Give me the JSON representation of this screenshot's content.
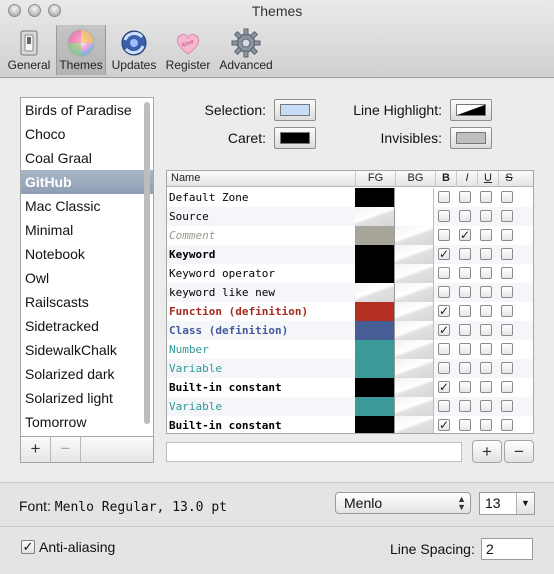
{
  "window": {
    "title": "Themes"
  },
  "toolbar": {
    "items": [
      {
        "label": "General",
        "icon": "switch-icon"
      },
      {
        "label": "Themes",
        "icon": "color-wheel-icon"
      },
      {
        "label": "Updates",
        "icon": "sync-globe-icon"
      },
      {
        "label": "Register",
        "icon": "candy-heart-icon"
      },
      {
        "label": "Advanced",
        "icon": "gear-icon"
      }
    ],
    "selected": "Themes"
  },
  "themes": {
    "items": [
      "Birds of Paradise",
      "Choco",
      "Coal Graal",
      "GitHub",
      "Mac Classic",
      "Minimal",
      "Notebook",
      "Owl",
      "Railscasts",
      "Sidetracked",
      "SidewalkChalk",
      "Solarized dark",
      "Solarized light",
      "Tomorrow"
    ],
    "selected": "GitHub",
    "add_label": "+",
    "remove_label": "−"
  },
  "wells": {
    "selection_label": "Selection:",
    "selection_color": "#c6dcf7",
    "caret_label": "Caret:",
    "caret_color": "#000000",
    "line_highlight_label": "Line Highlight:",
    "invisibles_label": "Invisibles:",
    "invisibles_color": "#bfbfbf"
  },
  "table": {
    "headers": {
      "name": "Name",
      "fg": "FG",
      "bg": "BG",
      "b": "B",
      "i": "I",
      "u": "U",
      "s": "S"
    },
    "rows": [
      {
        "name": "Default Zone",
        "fg": "#000000",
        "bg": "#ffffff",
        "b": false,
        "i": false,
        "u": false,
        "s": false,
        "color": "#000000",
        "bold": false,
        "italic": false
      },
      {
        "name": "Source",
        "fg": "",
        "bg": "#ffffff",
        "b": false,
        "i": false,
        "u": false,
        "s": false,
        "color": "#000000",
        "bold": false,
        "italic": false
      },
      {
        "name": "Comment",
        "fg": "#a8a59a",
        "bg": "",
        "b": false,
        "i": true,
        "u": false,
        "s": false,
        "color": "#9a9990",
        "bold": false,
        "italic": true
      },
      {
        "name": "Keyword",
        "fg": "#000000",
        "bg": "",
        "b": true,
        "i": false,
        "u": false,
        "s": false,
        "color": "#000000",
        "bold": true,
        "italic": false
      },
      {
        "name": "Keyword operator",
        "fg": "#000000",
        "bg": "",
        "b": false,
        "i": false,
        "u": false,
        "s": false,
        "color": "#000000",
        "bold": false,
        "italic": false
      },
      {
        "name": "keyword like new",
        "fg": "",
        "bg": "",
        "b": false,
        "i": false,
        "u": false,
        "s": false,
        "color": "#000000",
        "bold": false,
        "italic": false
      },
      {
        "name": "Function (definition)",
        "fg": "#b22f22",
        "bg": "",
        "b": true,
        "i": false,
        "u": false,
        "s": false,
        "color": "#a82a1e",
        "bold": true,
        "italic": false
      },
      {
        "name": "Class (definition)",
        "fg": "#475d96",
        "bg": "",
        "b": true,
        "i": false,
        "u": false,
        "s": false,
        "color": "#44599a",
        "bold": true,
        "italic": false
      },
      {
        "name": "Number",
        "fg": "#3a9a98",
        "bg": "",
        "b": false,
        "i": false,
        "u": false,
        "s": false,
        "color": "#2f9a97",
        "bold": false,
        "italic": false
      },
      {
        "name": "Variable",
        "fg": "#3a9a98",
        "bg": "",
        "b": false,
        "i": false,
        "u": false,
        "s": false,
        "color": "#2f9a97",
        "bold": false,
        "italic": false
      },
      {
        "name": "Built-in constant",
        "fg": "#000000",
        "bg": "",
        "b": true,
        "i": false,
        "u": false,
        "s": false,
        "color": "#000000",
        "bold": true,
        "italic": false
      },
      {
        "name": "Variable",
        "fg": "#3a9a98",
        "bg": "",
        "b": false,
        "i": false,
        "u": false,
        "s": false,
        "color": "#2f9a97",
        "bold": false,
        "italic": false
      },
      {
        "name": "Built-in constant",
        "fg": "#000000",
        "bg": "",
        "b": true,
        "i": false,
        "u": false,
        "s": false,
        "color": "#000000",
        "bold": true,
        "italic": false
      }
    ],
    "add_label": "+",
    "remove_label": "−"
  },
  "font": {
    "label": "Font:",
    "value": "Menlo Regular, 13.0 pt",
    "family_selected": "Menlo",
    "size": "13"
  },
  "antialiasing": {
    "label": "Anti-aliasing",
    "checked": true
  },
  "line_spacing": {
    "label": "Line Spacing:",
    "value": "2"
  }
}
